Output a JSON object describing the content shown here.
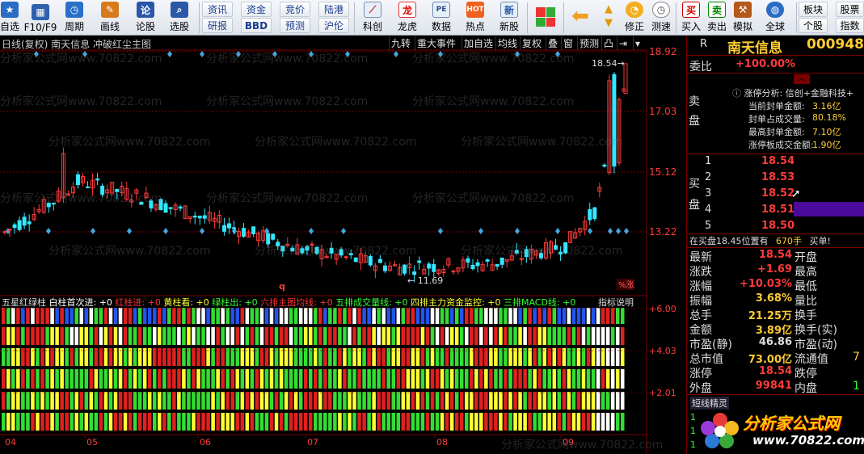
{
  "toolbar": {
    "items": [
      {
        "label": "自选",
        "icon": "star-icon"
      },
      {
        "label": "F10/F9",
        "icon": "grid-icon"
      },
      {
        "label": "周期",
        "icon": "cycle-icon"
      },
      {
        "label": "画线",
        "icon": "pencil-icon"
      },
      {
        "label": "论股",
        "icon": "discuss-icon"
      },
      {
        "label": "选股",
        "icon": "search-icon"
      }
    ],
    "top_buttons": [
      "资讯",
      "资金",
      "竞价",
      "陆港"
    ],
    "bottom_buttons": [
      "研报",
      "BBD",
      "预测",
      "沪伦"
    ],
    "items2": [
      {
        "label": "科创",
        "icon": "chart-icon"
      },
      {
        "label": "龙虎",
        "icon": "dragon-icon"
      },
      {
        "label": "数据",
        "icon": "data-icon"
      },
      {
        "label": "热点",
        "icon": "hot-icon"
      },
      {
        "label": "新股",
        "icon": "new-icon"
      }
    ],
    "items3": [
      {
        "label": "修正",
        "icon": "clock-icon"
      },
      {
        "label": "测速",
        "icon": "speed-icon"
      },
      {
        "label": "买入",
        "icon": "buy-icon"
      },
      {
        "label": "卖出",
        "icon": "sell-icon"
      },
      {
        "label": "模拟",
        "icon": "hammer-icon"
      },
      {
        "label": "全球",
        "icon": "globe-icon"
      }
    ],
    "right_top": [
      "板块",
      "股票"
    ],
    "right_bottom": [
      "个股",
      "指数"
    ],
    "buy_char": "买",
    "sell_char": "卖"
  },
  "chart_title": {
    "text": "日线(复权)  南天信息  冲破红尘主图",
    "tabs": [
      "九转",
      "重大事件",
      "加自选",
      "均线",
      "复权",
      "叠",
      "窗",
      "预测",
      "凸",
      "⇥",
      "▾"
    ]
  },
  "price_axis": [
    "18.92",
    "17.03",
    "15.12",
    "13.22"
  ],
  "price_labels": {
    "high": "18.54",
    "low": "11.69",
    "q_marker": "q",
    "badge": "%涨"
  },
  "indicator_bar": {
    "name": "五星红绿柱",
    "parts": [
      {
        "text": "白柱首次进: +0",
        "color": "#ffffff"
      },
      {
        "text": "红柱进: +0",
        "color": "#ff3333"
      },
      {
        "text": "黄柱看: +0",
        "color": "#ffff33"
      },
      {
        "text": "绿柱出: +0",
        "color": "#33ff33"
      },
      {
        "text": "六排主图均线: +0",
        "color": "#ff3333"
      },
      {
        "text": "五排成交量线: +0",
        "color": "#33ff33"
      },
      {
        "text": "四排主力资金监控: +0",
        "color": "#ffff33"
      },
      {
        "text": "三排MACD线: +0",
        "color": "#33ff33"
      }
    ],
    "help": "指标说明"
  },
  "indicator_axis": [
    "+6.00",
    "+4.03",
    "+2.01"
  ],
  "months": [
    "04",
    "05",
    "06",
    "07",
    "08",
    "09"
  ],
  "watermark": "分析家公式网www.70822.com",
  "panel": {
    "header_r": "R",
    "stock_name": "南天信息",
    "stock_code": "000948",
    "weibi_label": "委比",
    "weibi_value": "+100.00%",
    "analysis_title": "涨停分析: 信创+金融科技+",
    "analysis_rows": [
      {
        "label": "当前封单金额:",
        "value": "3.16亿"
      },
      {
        "label": "封单占成交量:",
        "value": "80.18%"
      },
      {
        "label": "最高封单金额:",
        "value": "7.10亿"
      },
      {
        "label": "涨停板成交金额:",
        "value": "1.90亿"
      }
    ],
    "sell_label": "卖盘",
    "buy_label": "买盘",
    "bids": [
      {
        "n": "1",
        "price": "18.54"
      },
      {
        "n": "2",
        "price": "18.53"
      },
      {
        "n": "3",
        "price": "18.52"
      },
      {
        "n": "4",
        "price": "18.51"
      },
      {
        "n": "5",
        "price": "18.50"
      }
    ],
    "bid_line": {
      "text": "在买盘18.45位置有",
      "qty": "670手",
      "action": "买单!"
    },
    "quotes": [
      {
        "l1": "最新",
        "v1": "18.54",
        "l2": "开盘"
      },
      {
        "l1": "涨跌",
        "v1": "+1.69",
        "l2": "最高"
      },
      {
        "l1": "涨幅",
        "v1": "+10.03%",
        "l2": "最低"
      },
      {
        "l1": "振幅",
        "v1": "3.68%",
        "l2": "量比"
      },
      {
        "l1": "总手",
        "v1": "21.25万",
        "l2": "换手"
      },
      {
        "l1": "金额",
        "v1": "3.89亿",
        "l2": "换手(实)"
      },
      {
        "l1": "市盈(静)",
        "v1": "46.86",
        "l2": "市盈(动)"
      },
      {
        "l1": "总市值",
        "v1": "73.00亿",
        "l2": "流通值"
      },
      {
        "l1": "涨停",
        "v1": "18.54",
        "l2": "跌停"
      },
      {
        "l1": "外盘",
        "v1": "99841",
        "l2": "内盘"
      }
    ],
    "quote_right_extra": [
      "7",
      "1"
    ],
    "short_title": "短线精灵",
    "short_rows": [
      "1",
      "1",
      "1"
    ],
    "logo_text": "分析家公式网",
    "logo_url": "www.70822.com"
  },
  "colors": {
    "up": "#ff3b3b",
    "down": "#33e8ff",
    "grid": "#7a0000"
  }
}
